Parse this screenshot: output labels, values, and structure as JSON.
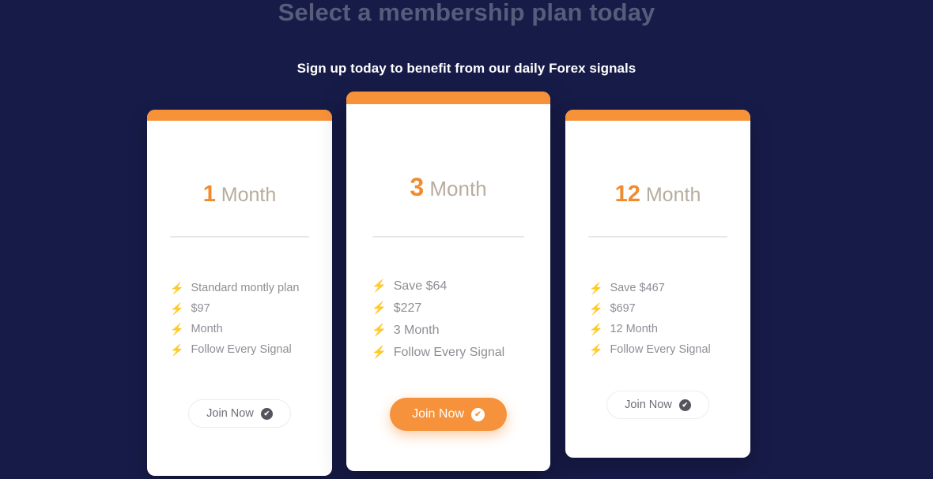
{
  "header": {
    "title": "Select a membership plan today",
    "subtitle": "Sign up today to benefit from our daily Forex signals"
  },
  "colors": {
    "background": "#171B48",
    "accent_orange": "#F5923B",
    "card_bar_orange": "#F79239",
    "title_muted": "#575C7B",
    "subtitle_white": "#FFFFFF",
    "feature_text": "#8E8E96",
    "plan_unit": "#B8AC9E",
    "plan_number": "#F08B2E",
    "divider": "#E7E7E9"
  },
  "icons": {
    "bolt": "⚡",
    "check": "✔"
  },
  "plans": [
    {
      "id": "basic",
      "number": "1",
      "unit": "Month",
      "featured": false,
      "features": [
        "Standard montly plan",
        "$97",
        "Month",
        "Follow Every Signal"
      ],
      "cta_label": "Join Now"
    },
    {
      "id": "quarterly",
      "number": "3",
      "unit": "Month",
      "featured": true,
      "features": [
        "Save $64",
        "$227",
        "3 Month",
        "Follow Every Signal"
      ],
      "cta_label": "Join Now"
    },
    {
      "id": "annual",
      "number": "12",
      "unit": "Month",
      "featured": false,
      "features": [
        "Save $467",
        "$697",
        "12 Month",
        "Follow Every Signal"
      ],
      "cta_label": "Join Now"
    }
  ]
}
